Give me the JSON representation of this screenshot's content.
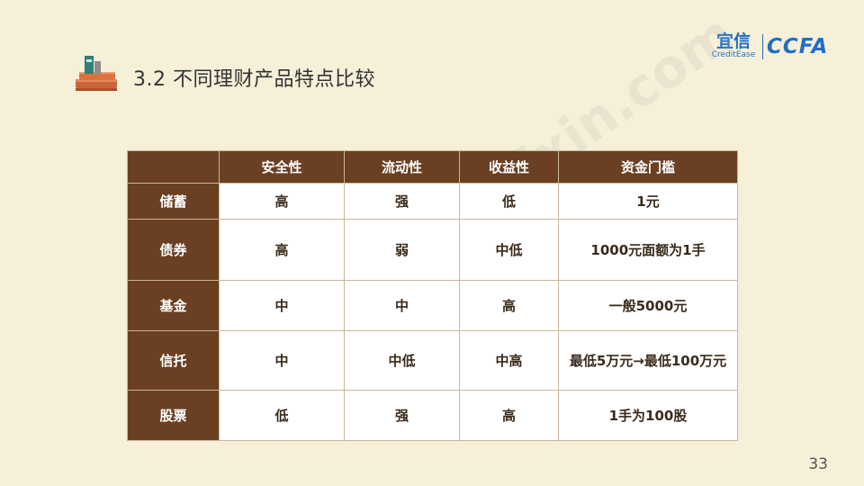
{
  "title": "3.2 不同理财产品特点比较",
  "logo": {
    "yixin": "宜信",
    "creditease": "CreditEase",
    "ccfa": "CCFA"
  },
  "watermark": {
    "text": "xinghuo.yixin.com"
  },
  "table": {
    "headers": [
      "",
      "安全性",
      "流动性",
      "收益性",
      "资金门槛"
    ],
    "rows": [
      {
        "label": "储蓄",
        "cells": [
          "高",
          "强",
          "低",
          "1元"
        ]
      },
      {
        "label": "债券",
        "cells": [
          "高",
          "弱",
          "中低",
          "1000元面额为1手"
        ]
      },
      {
        "label": "基金",
        "cells": [
          "中",
          "中",
          "高",
          "一般5000元"
        ]
      },
      {
        "label": "信托",
        "cells": [
          "中",
          "中低",
          "中高",
          "最低5万元→最低100万元"
        ]
      },
      {
        "label": "股票",
        "cells": [
          "低",
          "强",
          "高",
          "1手为100股"
        ]
      }
    ]
  },
  "page_number": "33",
  "colors": {
    "background": "#f6f0d9",
    "header_brown": "#6b3f22",
    "brand_blue": "#1f6fc4"
  }
}
